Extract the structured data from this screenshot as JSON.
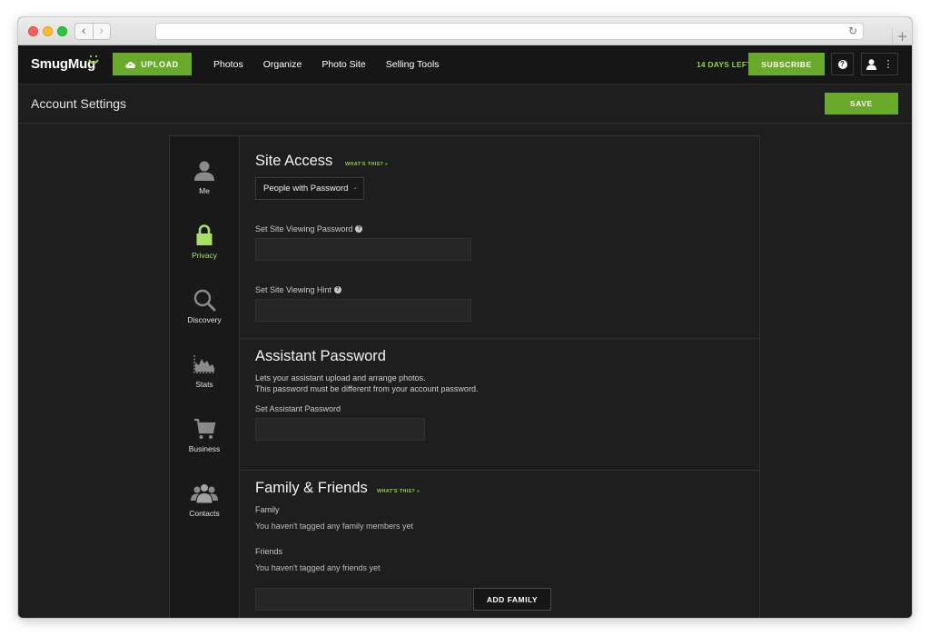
{
  "browser": {
    "back_glyph": "‹",
    "forward_glyph": "›",
    "reload_glyph": "↻",
    "newtab_glyph": "+"
  },
  "header": {
    "logo_text": "SmugMug",
    "upload_label": "UPLOAD",
    "nav": [
      "Photos",
      "Organize",
      "Photo Site",
      "Selling Tools"
    ],
    "trial_text": "14 DAYS LEFT",
    "subscribe_label": "SUBSCRIBE",
    "help_glyph": "?",
    "more_glyph": "⋮"
  },
  "page": {
    "title": "Account Settings",
    "save_label": "SAVE"
  },
  "sidebar": {
    "items": [
      {
        "label": "Me",
        "icon": "person-icon",
        "active": false
      },
      {
        "label": "Privacy",
        "icon": "lock-icon",
        "active": true
      },
      {
        "label": "Discovery",
        "icon": "magnifier-icon",
        "active": false
      },
      {
        "label": "Stats",
        "icon": "stats-chart-icon",
        "active": false
      },
      {
        "label": "Business",
        "icon": "cart-icon",
        "active": false
      },
      {
        "label": "Contacts",
        "icon": "people-icon",
        "active": false
      }
    ]
  },
  "site_access": {
    "title": "Site Access",
    "whats_this": "WHAT'S THIS? »",
    "selected_option": "People with Password",
    "chevron": "⌄",
    "password_label": "Set Site Viewing Password",
    "password_value": "",
    "hint_label": "Set Site Viewing Hint",
    "hint_value": "",
    "help_glyph": "?"
  },
  "assistant": {
    "title": "Assistant Password",
    "desc_line1": "Lets your assistant upload and arrange photos.",
    "desc_line2": "This password must be different from your account password.",
    "field_label": "Set Assistant Password",
    "field_value": ""
  },
  "family": {
    "title": "Family & Friends",
    "whats_this": "WHAT'S THIS? »",
    "family_label": "Family",
    "family_note": "You haven't tagged any family members yet",
    "friends_label": "Friends",
    "friends_note": "You haven't tagged any friends yet",
    "add_input_value": "",
    "add_label": "ADD FAMILY"
  },
  "colors": {
    "accent": "#6aaa2a",
    "accent_text": "#8fd13f",
    "active_item": "#a8e063",
    "background": "#1e1e1f",
    "topbar": "#161617"
  }
}
